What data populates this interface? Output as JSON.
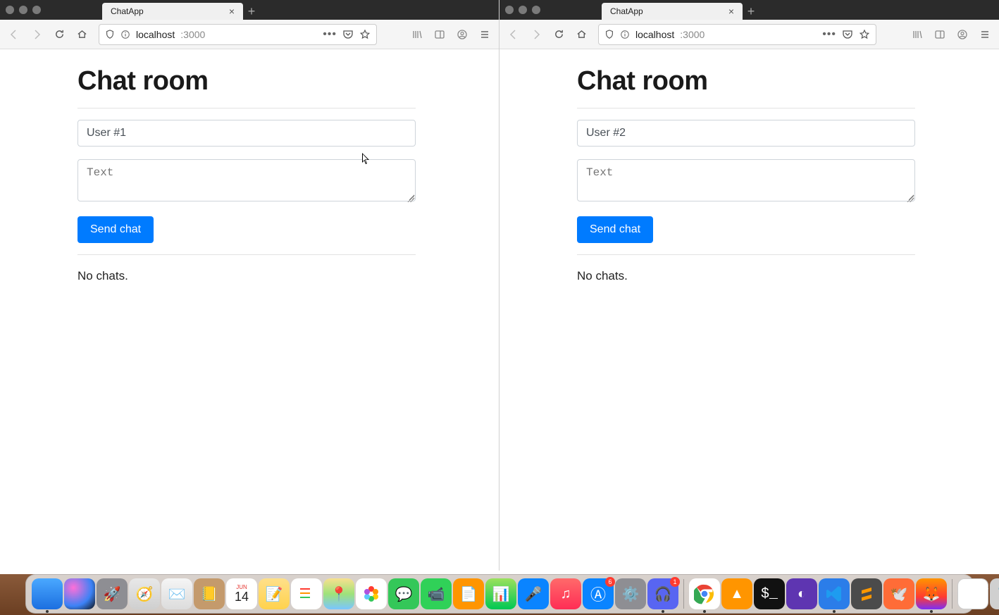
{
  "windows": [
    {
      "tab_title": "ChatApp",
      "url_host": "localhost",
      "url_port": ":3000",
      "page": {
        "heading": "Chat room",
        "username_value": "User #1",
        "message_placeholder": "Text",
        "message_value": "",
        "send_label": "Send chat",
        "empty_state": "No chats."
      }
    },
    {
      "tab_title": "ChatApp",
      "url_host": "localhost",
      "url_port": ":3000",
      "page": {
        "heading": "Chat room",
        "username_value": "User #2",
        "message_placeholder": "Text",
        "message_value": "",
        "send_label": "Send chat",
        "empty_state": "No chats."
      }
    }
  ],
  "dock": {
    "calendar_month": "JUN",
    "calendar_day": "14",
    "appstore_badge": "6",
    "discord_badge": "1",
    "terminal_glyph": "$_"
  }
}
